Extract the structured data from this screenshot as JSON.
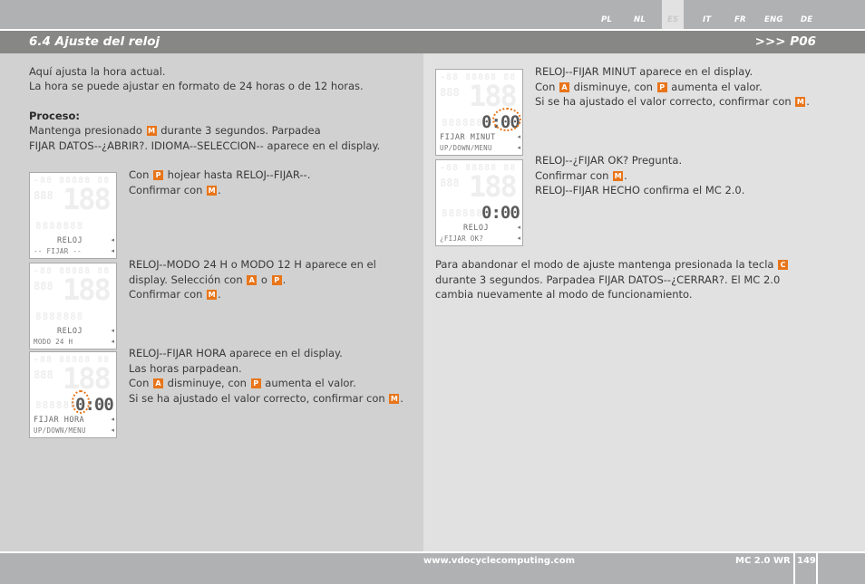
{
  "languages": [
    {
      "code": "PL",
      "active": false
    },
    {
      "code": "NL",
      "active": false
    },
    {
      "code": "ES",
      "active": true
    },
    {
      "code": "IT",
      "active": false
    },
    {
      "code": "FR",
      "active": false
    },
    {
      "code": "ENG",
      "active": false
    },
    {
      "code": "DE",
      "active": false
    }
  ],
  "header": {
    "section_title": "6.4 Ajuste del reloj",
    "page_ref": ">>> P06"
  },
  "intro": {
    "line1": "Aquí ajusta la hora actual.",
    "line2": "La hora se puede ajustar en formato de 24 horas o de 12 horas.",
    "proceso_label": "Proceso:",
    "proceso_line1_a": "Mantenga presionado ",
    "proceso_line1_key": "M",
    "proceso_line1_b": " durante 3 segundos. Parpadea",
    "proceso_line2": "FIJAR DATOS--¿ABRIR?. IDIOMA--SELECCION-- aparece en el display."
  },
  "steps": [
    {
      "display": {
        "label1": "RELOJ",
        "label2": "-- FIJAR --",
        "digits": "",
        "blink": false
      },
      "lines": [
        [
          "Con ",
          {
            "key": "P"
          },
          " hojear hasta RELOJ--FIJAR--."
        ],
        [
          "Confirmar con ",
          {
            "key": "M"
          },
          "."
        ]
      ]
    },
    {
      "display": {
        "label1": "RELOJ",
        "label2": "MODO 24 H",
        "digits": "",
        "blink": false
      },
      "lines": [
        [
          "RELOJ--MODO 24 H o MODO 12 H aparece en el"
        ],
        [
          "display. Selección con ",
          {
            "key": "A"
          },
          " o ",
          {
            "key": "P"
          },
          "."
        ],
        [
          "Confirmar con ",
          {
            "key": "M"
          },
          "."
        ]
      ]
    },
    {
      "display": {
        "label1": "FIJAR HORA",
        "label2": "UP/DOWN/MENU",
        "digits": "0:00",
        "blink": "hours"
      },
      "lines": [
        [
          "RELOJ--FIJAR HORA aparece en el display."
        ],
        [
          "Las horas parpadean."
        ],
        [
          "Con ",
          {
            "key": "A"
          },
          " disminuye, con ",
          {
            "key": "P"
          },
          " aumenta el valor."
        ],
        [
          "Si se ha ajustado el valor correcto, confirmar con ",
          {
            "key": "M"
          },
          "."
        ]
      ]
    },
    {
      "display": {
        "label1": "FIJAR MINUT",
        "label2": "UP/DOWN/MENU",
        "digits": "0:00",
        "blink": "minutes"
      },
      "lines": [
        [
          "RELOJ--FIJAR MINUT aparece en el display."
        ],
        [
          "Con ",
          {
            "key": "A"
          },
          " disminuye, con ",
          {
            "key": "P"
          },
          " aumenta el valor."
        ],
        [
          "Si se ha ajustado el valor correcto, confirmar con ",
          {
            "key": "M"
          },
          "."
        ]
      ]
    },
    {
      "display": {
        "label1": "RELOJ",
        "label2": "¿FIJAR OK?",
        "digits": "0:00",
        "blink": false
      },
      "lines": [
        [
          "RELOJ--¿FIJAR OK? Pregunta."
        ],
        [
          "Confirmar con ",
          {
            "key": "M"
          },
          "."
        ],
        [
          "RELOJ--FIJAR HECHO confirma el MC 2.0."
        ]
      ]
    }
  ],
  "exit_note": {
    "lines": [
      [
        "Para abandonar el modo de ajuste mantenga presionada la tecla ",
        {
          "key": "C"
        }
      ],
      [
        "durante 3 segundos. Parpadea FIJAR DATOS--¿CERRAR?. El MC 2.0"
      ],
      [
        "cambia nuevamente al modo de funcionamiento."
      ]
    ]
  },
  "lcd_ghost": {
    "row1": "-88 88888 88",
    "row2": "888",
    "big": "188",
    "row4": "8888888"
  },
  "footer": {
    "url": "www.vdocyclecomputing.com",
    "model": "MC 2.0 WR",
    "page_number": "149"
  },
  "colors": {
    "key_accent": "#e8751a",
    "header_band": "#878785",
    "top_bar": "#b0b1b2",
    "left_panel": "#d0d1d0",
    "right_panel": "#e1e1e1"
  }
}
